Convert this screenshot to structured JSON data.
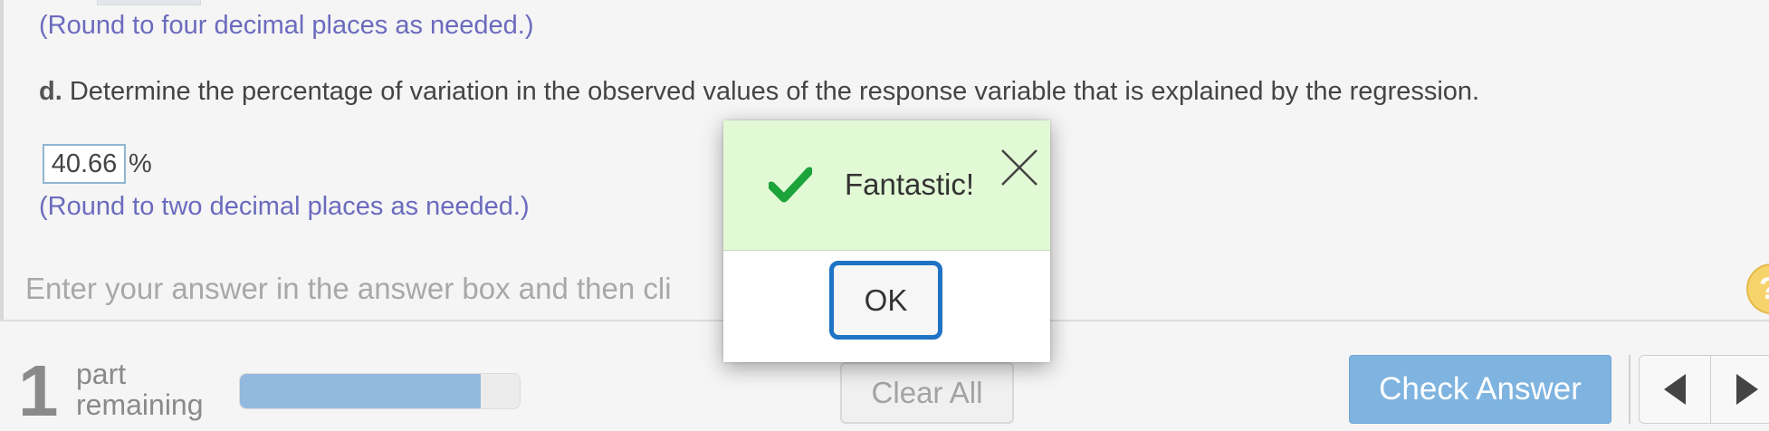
{
  "question": {
    "hint_above": "(Round to four decimal places as needed.)",
    "part_label": "d.",
    "part_text": "Determine the percentage of variation in the observed values of the response variable that is explained by the regression.",
    "answer_value": "40.66",
    "answer_unit": "%",
    "hint_below": "(Round to two decimal places as needed.)",
    "instruction": "Enter your answer in the answer box and then cli"
  },
  "help": {
    "icon": "help-icon",
    "glyph": "?"
  },
  "footer": {
    "parts_count": "1",
    "parts_label_line1": "part",
    "parts_label_line2": "remaining",
    "progress_fraction": 0.86,
    "clear_all_label": "Clear All",
    "check_answer_label": "Check Answer",
    "prev_icon": "triangle-left-icon",
    "next_icon": "triangle-right-icon"
  },
  "modal": {
    "message": "Fantastic!",
    "ok_label": "OK",
    "check_icon": "checkmark-icon",
    "close_icon": "close-icon"
  },
  "colors": {
    "hint_text": "#6b6bbf",
    "modal_header_bg": "#e2f9d6",
    "checkmark": "#1ca33a",
    "check_answer_bg": "#7fb4e0",
    "progress_fill": "#93b9de",
    "ok_border": "#1e73c4"
  }
}
